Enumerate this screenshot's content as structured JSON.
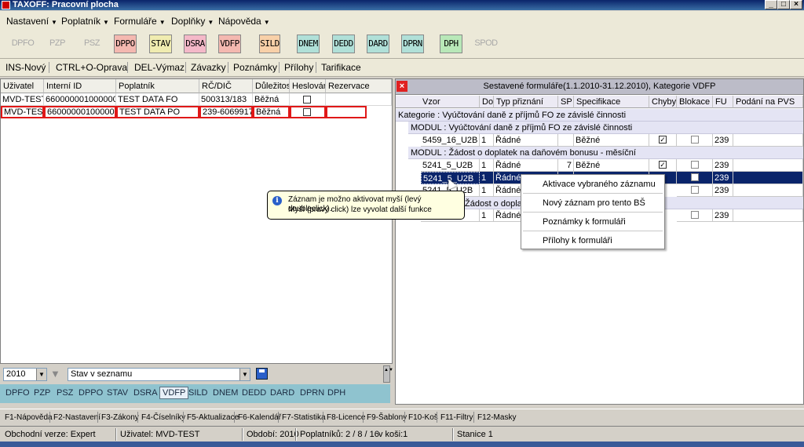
{
  "window": {
    "title": "TAXOFF: Pracovní plocha"
  },
  "menubar": [
    "Nastavení",
    "Poplatník",
    "Formuláře",
    "Doplňky",
    "Nápověda"
  ],
  "toolbar": {
    "buttons": [
      {
        "label": "DPFO",
        "enabled": false,
        "color": ""
      },
      {
        "label": "PZP",
        "enabled": false,
        "color": ""
      },
      {
        "label": "PSZ",
        "enabled": false,
        "color": ""
      },
      {
        "label": "DPPO",
        "enabled": true,
        "color": "#f4b8b0"
      },
      {
        "label": "STAV",
        "enabled": true,
        "color": "#f0ecb0"
      },
      {
        "label": "DSRA",
        "enabled": true,
        "color": "#f4b8c8"
      },
      {
        "label": "VDFP",
        "enabled": true,
        "color": "#f4b8b0"
      },
      {
        "label": "SILD",
        "enabled": true,
        "color": "#f8d0a8"
      },
      {
        "label": "DNEM",
        "enabled": true,
        "color": "#b0e0d8"
      },
      {
        "label": "DEDD",
        "enabled": true,
        "color": "#b0e0d8"
      },
      {
        "label": "DARD",
        "enabled": true,
        "color": "#b0e0d8"
      },
      {
        "label": "DPRN",
        "enabled": true,
        "color": "#b0e0d8"
      },
      {
        "label": "DPH",
        "enabled": true,
        "color": "#b8e8b8"
      },
      {
        "label": "SPOD",
        "enabled": false,
        "color": ""
      }
    ]
  },
  "actions": [
    "INS-Nový",
    "CTRL+O-Oprava",
    "DEL-Výmaz",
    "Závazky",
    "Poznámky",
    "Přílohy",
    "Tarifikace"
  ],
  "left_table": {
    "columns": [
      "Uživatel",
      "Interní ID",
      "Poplatník",
      "RČ/DIČ",
      "Důležitost",
      "Heslován",
      "Rezervace"
    ],
    "rows": [
      {
        "user": "MVD-TEST",
        "id": "6600000010000005",
        "payer": "TEST DATA FO",
        "rc": "500313/183",
        "priority": "Běžná",
        "password": false,
        "reserve": ""
      },
      {
        "user": "MVD-TEST",
        "id": "6600000010000002",
        "payer": "TEST DATA PO",
        "rc": "239-60699175",
        "priority": "Běžná",
        "password": false,
        "reserve": ""
      }
    ]
  },
  "left_bottom": {
    "year": "2010",
    "status_filter": "Stav v seznamu",
    "tabs": [
      "DPFO",
      "PZP",
      "PSZ",
      "DPPO",
      "STAV",
      "DSRA",
      "VDFP",
      "SILD",
      "DNEM",
      "DEDD",
      "DARD",
      "DPRN",
      "DPH"
    ],
    "active_tab": "VDFP"
  },
  "right_panel": {
    "title": "Sestavené formuláře(1.1.2010-31.12.2010), Kategorie VDFP",
    "columns": [
      "Vzor",
      "Do",
      "Typ přiznání",
      "SP",
      "Specifikace",
      "Chyby",
      "Blokace",
      "FU",
      "Podání na PVS"
    ],
    "category": "Kategorie : Vyúčtování daně z příjmů FO ze závislé činnosti",
    "module1": "MODUL : Vyúčtování daně z příjmů FO ze závislé činnosti",
    "module2": "MODUL : Žádost o doplatek na daňovém bonusu - měsíční",
    "module3_partial": "Žádost o doplatek na d",
    "rows": [
      {
        "vzor": "5459_16_U2B",
        "do": "1",
        "typ": "Řádné",
        "sp": "",
        "spec": "Běžné",
        "chyby": true,
        "blokace": false,
        "fu": "239"
      },
      {
        "vzor": "5241_5_U2B",
        "do": "1",
        "typ": "Řádné",
        "sp": "7",
        "spec": "Běžné",
        "chyby": true,
        "blokace": false,
        "fu": "239"
      },
      {
        "vzor": "5241_5_U2B",
        "do": "1",
        "typ": "Řádné",
        "sp": "",
        "spec": "",
        "chyby": false,
        "blokace": false,
        "fu": "239"
      },
      {
        "vzor": "5241_5_U2B",
        "do": "1",
        "typ": "Řádné",
        "sp": "",
        "spec": "",
        "chyby": false,
        "blokace": false,
        "fu": "239"
      },
      {
        "vzor": "",
        "do": "1",
        "typ": "Řádné",
        "sp": "",
        "spec": "",
        "chyby": false,
        "blokace": false,
        "fu": "239"
      }
    ]
  },
  "tooltip": {
    "line1": "Záznam je možno aktivovat myší (levý doubleclick).",
    "line2": "Myší (pravý click) lze vyvolat další funkce"
  },
  "context_menu": [
    "Aktivace vybraného záznamu",
    "Nový záznam pro tento BŠ",
    "Poznámky k formuláři",
    "Přílohy k formuláři"
  ],
  "fkeys": [
    "F1-Nápověda",
    "F2-Nastavení",
    "F3-Zákony",
    "F4-Číselníky",
    "F5-Aktualizace",
    "F6-Kalendář",
    "F7-Statistika",
    "F8-Licence",
    "F9-Šablony",
    "F10-Koš",
    "F11-Filtry",
    "F12-Masky"
  ],
  "statusbar": {
    "version": "Obchodní verze: Expert",
    "user": "Uživatel: MVD-TEST",
    "period": "Období: 2010",
    "payers": "Poplatníků: 2 / 8 / 16",
    "koi": "v koši:1",
    "station": "Stanice 1"
  }
}
